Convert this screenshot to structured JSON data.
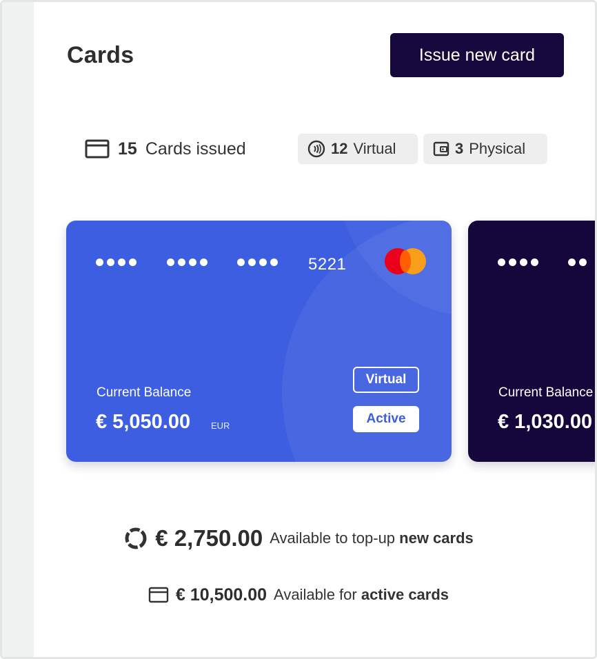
{
  "header": {
    "title": "Cards",
    "issue_button": "Issue new card"
  },
  "stats": {
    "issued_count": "15",
    "issued_label": "Cards issued",
    "virtual_count": "12",
    "virtual_label": "Virtual",
    "physical_count": "3",
    "physical_label": "Physical"
  },
  "cards": [
    {
      "masked_groups": [
        "••••",
        "••••",
        "••••"
      ],
      "last4": "5221",
      "brand": "mastercard-logo",
      "balance_label": "Current Balance",
      "balance": "€ 5,050.00",
      "currency": "EUR",
      "type_tag": "Virtual",
      "status_tag": "Active",
      "color": "#3d5ee0"
    },
    {
      "balance_label": "Current Balance",
      "balance": "€ 1,030.00",
      "color": "#15073b"
    }
  ],
  "summary": {
    "topup_amount": "€ 2,750.00",
    "topup_text": "Available to top-up ",
    "topup_strong": "new cards",
    "active_amount": "€ 10,500.00",
    "active_text": "Available for ",
    "active_strong": "active cards"
  },
  "colors": {
    "accent_dark": "#17083e",
    "card_blue": "#3d5ee0",
    "card_dark": "#15073b",
    "pill_bg": "#eeeeee"
  },
  "icons": [
    "credit-card-icon",
    "contactless-icon",
    "wallet-icon",
    "progress-ring-icon",
    "card-outline-icon"
  ]
}
